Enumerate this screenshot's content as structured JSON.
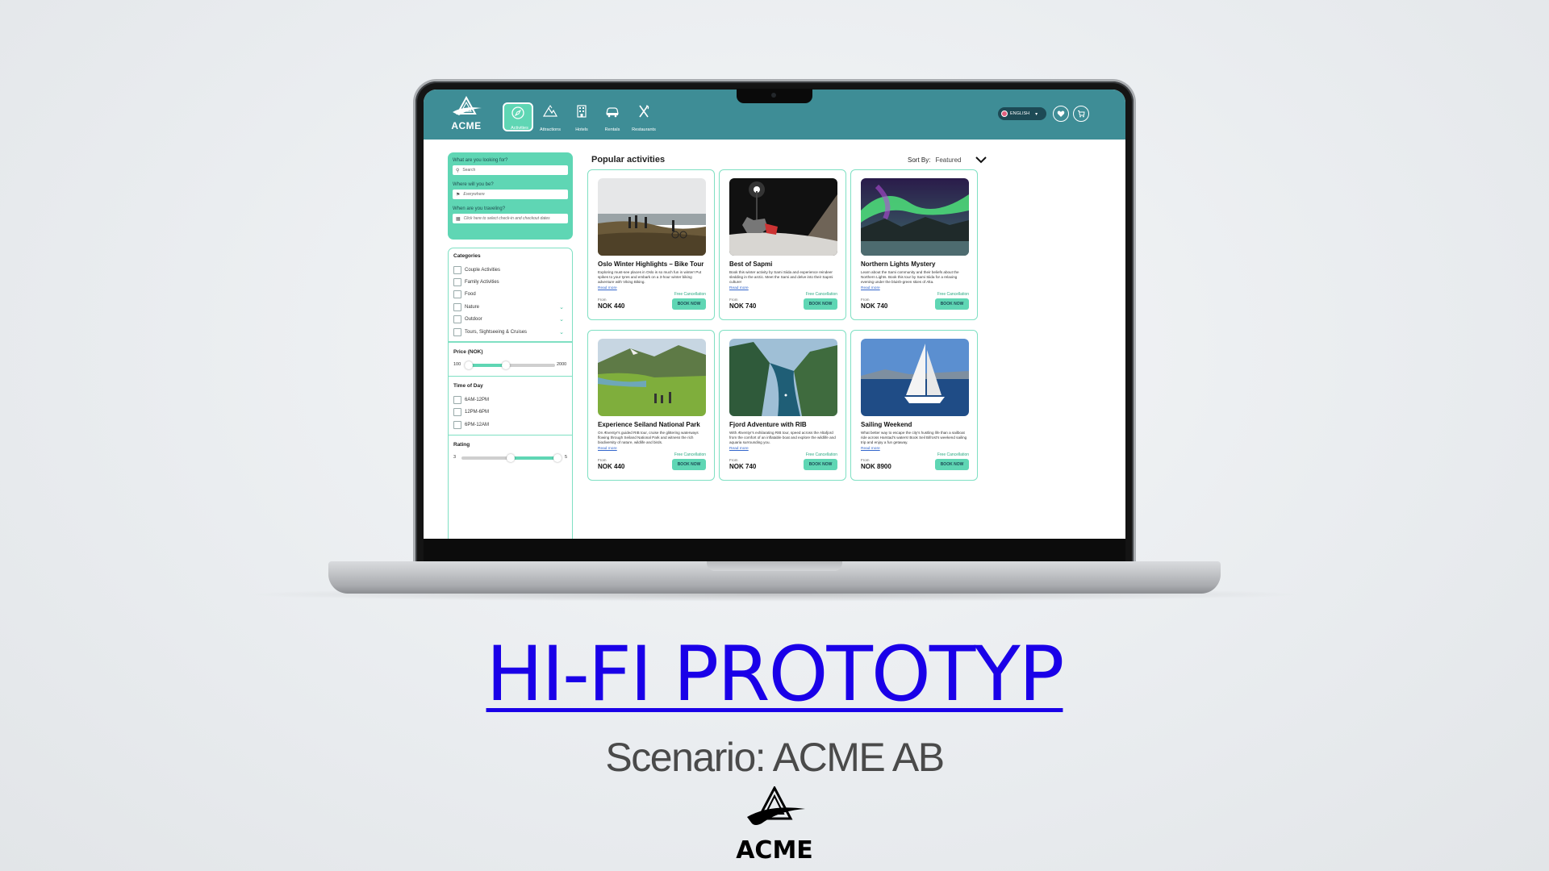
{
  "app": {
    "logo_text": "ACME",
    "nav": [
      {
        "label": "Activities",
        "icon": "compass-icon"
      },
      {
        "label": "Attractions",
        "icon": "mountain-icon"
      },
      {
        "label": "Hotels",
        "icon": "building-icon"
      },
      {
        "label": "Rentals",
        "icon": "car-icon"
      },
      {
        "label": "Restaurants",
        "icon": "utensils-icon"
      }
    ],
    "language": "ENGLISH"
  },
  "search": {
    "looking_label": "What are you looking for?",
    "looking_placeholder": "Search",
    "where_label": "Where will you be?",
    "where_value": "Everywhere",
    "when_label": "When are you traveling?",
    "when_value": "Click here to select check-in and checkout dates"
  },
  "filters": {
    "categories_title": "Categories",
    "categories": [
      "Couple Activities",
      "Family Activities",
      "Food",
      "Nature",
      "Outdoor",
      "Tours, Sightseeing & Cruises"
    ],
    "price_title": "Price (NOK)",
    "price_min": "100",
    "price_max": "2000",
    "time_title": "Time of Day",
    "times": [
      "6AM-12PM",
      "12PM-6PM",
      "6PM-12AM"
    ],
    "rating_title": "Rating",
    "rating_min": "3",
    "rating_max": "5"
  },
  "main": {
    "title": "Popular activities",
    "sort_label": "Sort By:",
    "sort_value": "Featured"
  },
  "cards": [
    {
      "title": "Oslo Winter Highlights – Bike Tour",
      "desc": "Exploring must-see places in Oslo is so much fun in winter! Put spikes to your tyres and embark on a 3-hour winter biking adventure with Viking Biking.",
      "read_more": "Read more",
      "free": "Free Cancellation",
      "from": "From",
      "price": "NOK 440",
      "book": "BOOK NOW"
    },
    {
      "title": "Best of Sapmi",
      "desc": "Book this winter activity by Sami Siida and experience reindeer sledding in the arctic. Meet the Sami and delve into their Sapmi culture!",
      "read_more": "Read more",
      "free": "Free Cancellation",
      "from": "From",
      "price": "NOK 740",
      "book": "BOOK NOW"
    },
    {
      "title": "Northern Lights Mystery",
      "desc": "Learn about the Sami community and their beliefs about the Northern Lights. Book this tour by Sami Siida for a relaxing evening under the bluish-green skies of Alta.",
      "read_more": "Read more",
      "free": "Free Cancellation",
      "from": "From",
      "price": "NOK 740",
      "book": "BOOK NOW"
    },
    {
      "title": "Experience Seiland National Park",
      "desc": "On Æventyr's guided RIB tour, cruise the glittering waterways flowing through Seiland National Park and witness the rich biodiversity of nature, wildlife and birds.",
      "read_more": "Read more",
      "free": "Free Cancellation",
      "from": "From",
      "price": "NOK 440",
      "book": "BOOK NOW"
    },
    {
      "title": "Fjord Adventure with RIB",
      "desc": "With Æventyr's exhilarating RIB tour, speed across the Altafjord from the comfort of an inflatable boat and explore the wildlife and aquaria surrounding you.",
      "read_more": "Read more",
      "free": "Free Cancellation",
      "from": "From",
      "price": "NOK 740",
      "book": "BOOK NOW"
    },
    {
      "title": "Sailing Weekend",
      "desc": "What better way to escape the city's hustling life than a sailboat ride across Harstad's waters! Book Seil Bifrost's weekend sailing trip and enjoy a fun getaway.",
      "read_more": "Read more",
      "free": "Free Cancellation",
      "from": "From",
      "price": "NOK 8900",
      "book": "BOOK NOW"
    }
  ],
  "slide": {
    "headline": "HI-FI PROTOTYP",
    "subtitle": "Scenario: ACME AB",
    "logo_text": "ACME"
  }
}
